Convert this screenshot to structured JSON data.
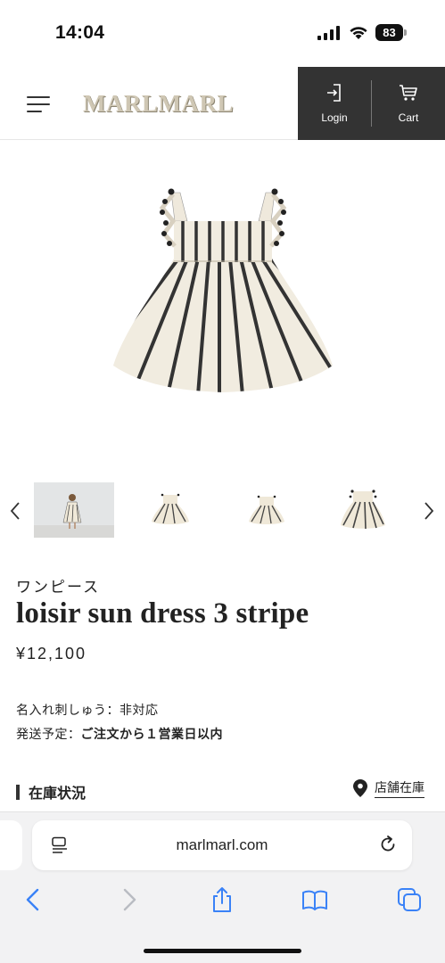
{
  "status_bar": {
    "time": "14:04",
    "battery": "83",
    "icons": [
      "signal-icon",
      "wifi-icon",
      "battery-icon"
    ]
  },
  "header": {
    "logo": "MARLMARL",
    "login_label": "Login",
    "cart_label": "Cart",
    "icons": [
      "hamburger-menu-icon",
      "login-icon",
      "cart-icon"
    ]
  },
  "product": {
    "category": "ワンピース",
    "title": "loisir sun dress 3 stripe",
    "price": "¥12,100",
    "embroidery": "名入れ刺しゅう：非対応",
    "shipping_label": "発送予定：",
    "shipping_value": "ご注文から１営業日以内",
    "stock_heading": "在庫状況",
    "store_stock": "店舗在庫"
  },
  "thumbnails": {
    "count_visible": 4,
    "icons": [
      "chevron-left-icon",
      "chevron-right-icon"
    ]
  },
  "browser": {
    "url": "marlmarl.com",
    "icons": [
      "reader-icon",
      "reload-icon",
      "back-icon",
      "forward-icon",
      "share-icon",
      "bookmarks-icon",
      "tabs-icon"
    ]
  },
  "colors": {
    "header_dark": "#333333",
    "logo": "#cfc7b4",
    "ios_blue": "#3a82f7",
    "browser_bg": "#f2f2f3"
  }
}
